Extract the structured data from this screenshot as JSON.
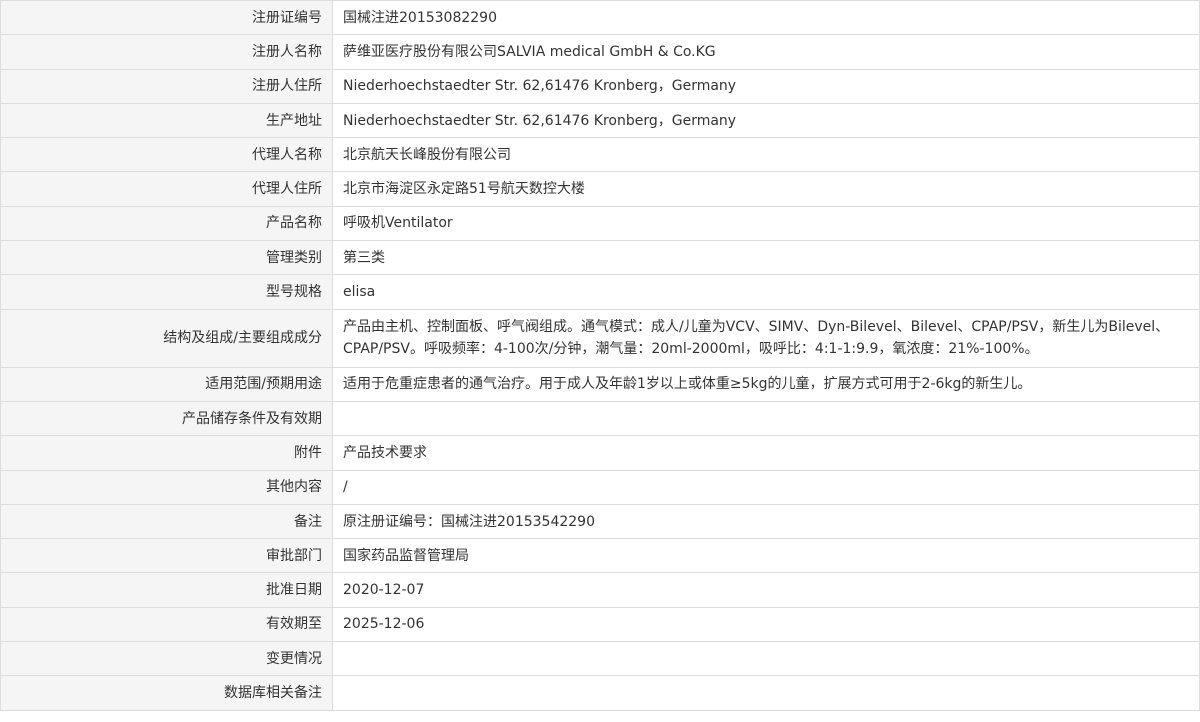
{
  "record": {
    "rows": [
      {
        "label": "注册证编号",
        "value": "国械注进20153082290"
      },
      {
        "label": "注册人名称",
        "value": "萨维亚医疗股份有限公司SALVIA medical GmbH & Co.KG"
      },
      {
        "label": "注册人住所",
        "value": "Niederhoechstaedter Str. 62,61476 Kronberg，Germany"
      },
      {
        "label": "生产地址",
        "value": "Niederhoechstaedter Str. 62,61476 Kronberg，Germany"
      },
      {
        "label": "代理人名称",
        "value": "北京航天长峰股份有限公司"
      },
      {
        "label": "代理人住所",
        "value": "北京市海淀区永定路51号航天数控大楼"
      },
      {
        "label": "产品名称",
        "value": "呼吸机Ventilator"
      },
      {
        "label": "管理类别",
        "value": "第三类"
      },
      {
        "label": "型号规格",
        "value": "elisa"
      },
      {
        "label": "结构及组成/主要组成成分",
        "value": "产品由主机、控制面板、呼气阀组成。通气模式：成人/儿童为VCV、SIMV、Dyn-Bilevel、Bilevel、CPAP/PSV，新生儿为Bilevel、CPAP/PSV。呼吸频率：4-100次/分钟，潮气量：20ml-2000ml，吸呼比：4:1-1:9.9，氧浓度：21%-100%。"
      },
      {
        "label": "适用范围/预期用途",
        "value": "适用于危重症患者的通气治疗。用于成人及年龄1岁以上或体重≥5kg的儿童，扩展方式可用于2-6kg的新生儿。"
      },
      {
        "label": "产品储存条件及有效期",
        "value": ""
      },
      {
        "label": "附件",
        "value": "产品技术要求"
      },
      {
        "label": "其他内容",
        "value": "/"
      },
      {
        "label": "备注",
        "value": "原注册证编号：国械注进20153542290"
      },
      {
        "label": "审批部门",
        "value": "国家药品监督管理局"
      },
      {
        "label": "批准日期",
        "value": "2020-12-07"
      },
      {
        "label": "有效期至",
        "value": "2025-12-06"
      },
      {
        "label": "变更情况",
        "value": ""
      },
      {
        "label": "数据库相关备注",
        "value": ""
      }
    ]
  }
}
